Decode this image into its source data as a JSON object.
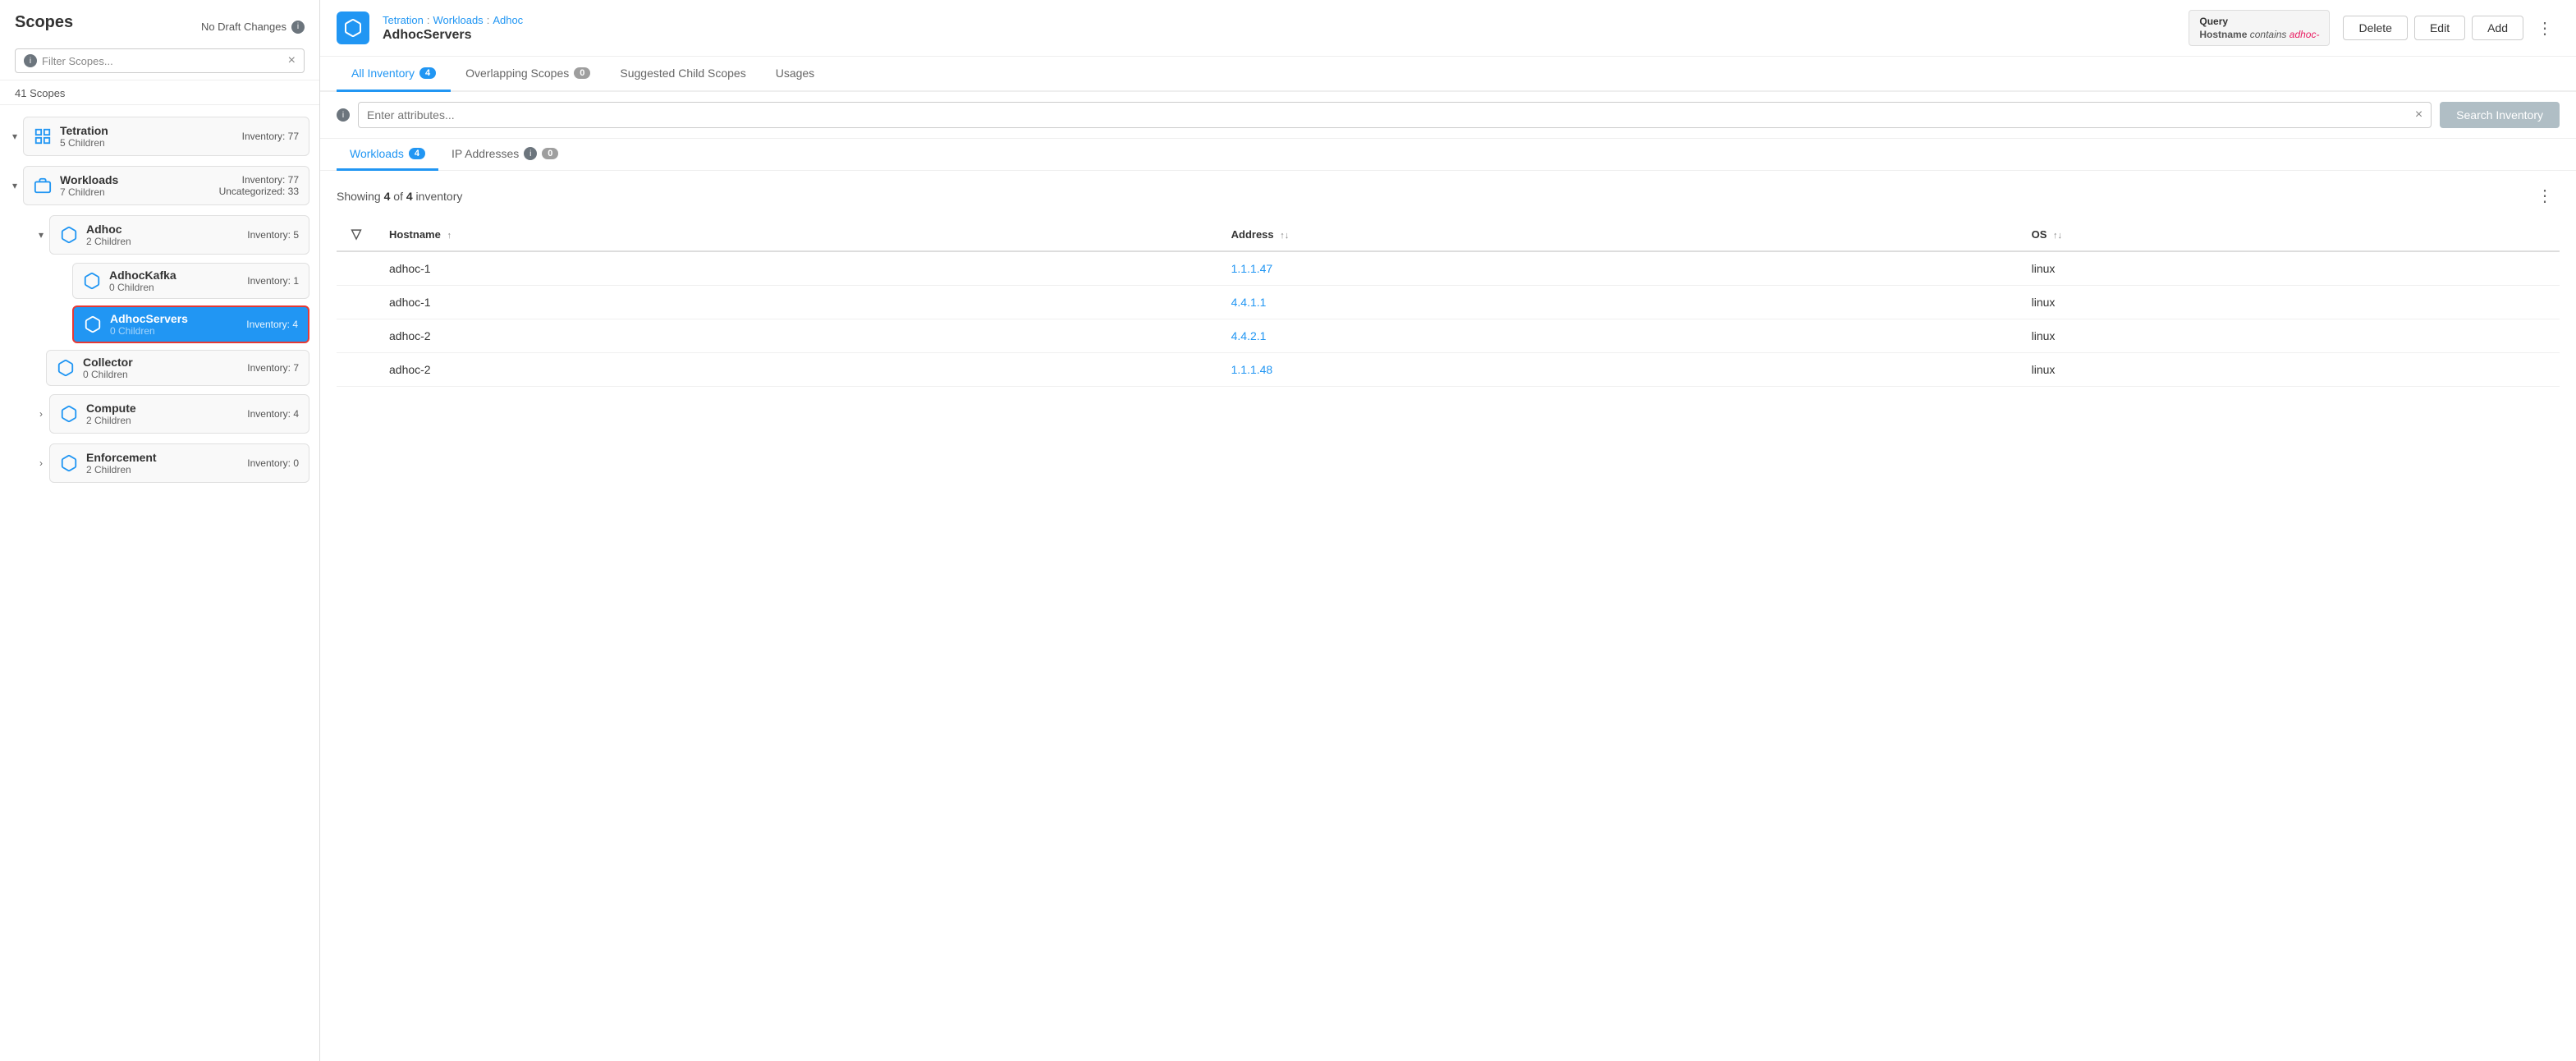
{
  "sidebar": {
    "title": "Scopes",
    "no_draft": "No Draft Changes",
    "filter_placeholder": "Filter Scopes...",
    "scope_count": "41 Scopes",
    "scopes": [
      {
        "id": "tetration",
        "name": "Tetration",
        "children_label": "5 Children",
        "inventory": "Inventory: 77",
        "expanded": true,
        "chevron": "▾",
        "has_grid_icon": true,
        "children": []
      },
      {
        "id": "workloads",
        "name": "Workloads",
        "children_label": "7 Children",
        "inventory": "Inventory: 77",
        "inventory2": "Uncategorized: 33",
        "expanded": true,
        "chevron": "▾",
        "children": [
          {
            "id": "adhoc",
            "name": "Adhoc",
            "children_label": "2 Children",
            "inventory": "Inventory: 5",
            "expanded": true,
            "chevron": "▾",
            "children": [
              {
                "id": "adhockafka",
                "name": "AdhocKafka",
                "children_label": "0 Children",
                "inventory": "Inventory: 1",
                "active": false
              },
              {
                "id": "adhocservers",
                "name": "AdhocServers",
                "children_label": "0 Children",
                "inventory": "Inventory: 4",
                "active": true
              }
            ]
          },
          {
            "id": "collector",
            "name": "Collector",
            "children_label": "0 Children",
            "inventory": "Inventory: 7",
            "active": false,
            "chevron": ""
          },
          {
            "id": "compute",
            "name": "Compute",
            "children_label": "2 Children",
            "inventory": "Inventory: 4",
            "active": false,
            "chevron": "›"
          },
          {
            "id": "enforcement",
            "name": "Enforcement",
            "children_label": "2 Children",
            "inventory": "Inventory: 0",
            "active": false,
            "chevron": "›"
          }
        ]
      }
    ]
  },
  "topbar": {
    "breadcrumb": {
      "parts": [
        "Tetration",
        "Workloads",
        "Adhoc"
      ],
      "separator": ":",
      "current": "AdhocServers"
    },
    "query": {
      "label": "Query",
      "text": "Hostname contains adhoc-"
    },
    "buttons": {
      "delete": "Delete",
      "edit": "Edit",
      "add": "Add"
    }
  },
  "tabs": [
    {
      "id": "all-inventory",
      "label": "All Inventory",
      "badge": "4",
      "active": true
    },
    {
      "id": "overlapping-scopes",
      "label": "Overlapping Scopes",
      "badge": "0",
      "badge_grey": true,
      "active": false
    },
    {
      "id": "suggested-child-scopes",
      "label": "Suggested Child Scopes",
      "badge": null,
      "active": false
    },
    {
      "id": "usages",
      "label": "Usages",
      "badge": null,
      "active": false
    }
  ],
  "search": {
    "placeholder": "Enter attributes...",
    "button_label": "Search Inventory"
  },
  "sub_tabs": [
    {
      "id": "workloads",
      "label": "Workloads",
      "badge": "4",
      "active": true
    },
    {
      "id": "ip-addresses",
      "label": "IP Addresses",
      "badge": "0",
      "has_info": true,
      "active": false
    }
  ],
  "inventory": {
    "showing": "Showing",
    "count": "4",
    "of": "of",
    "total": "4",
    "unit": "inventory",
    "columns": [
      {
        "id": "hostname",
        "label": "Hostname",
        "sortable": true,
        "sort_dir": "asc"
      },
      {
        "id": "address",
        "label": "Address",
        "sortable": true
      },
      {
        "id": "os",
        "label": "OS",
        "sortable": true
      }
    ],
    "rows": [
      {
        "hostname": "adhoc-1",
        "address": "1.1.1.47",
        "os": "linux"
      },
      {
        "hostname": "adhoc-1",
        "address": "4.4.1.1",
        "os": "linux"
      },
      {
        "hostname": "adhoc-2",
        "address": "4.4.2.1",
        "os": "linux"
      },
      {
        "hostname": "adhoc-2",
        "address": "1.1.1.48",
        "os": "linux"
      }
    ]
  }
}
